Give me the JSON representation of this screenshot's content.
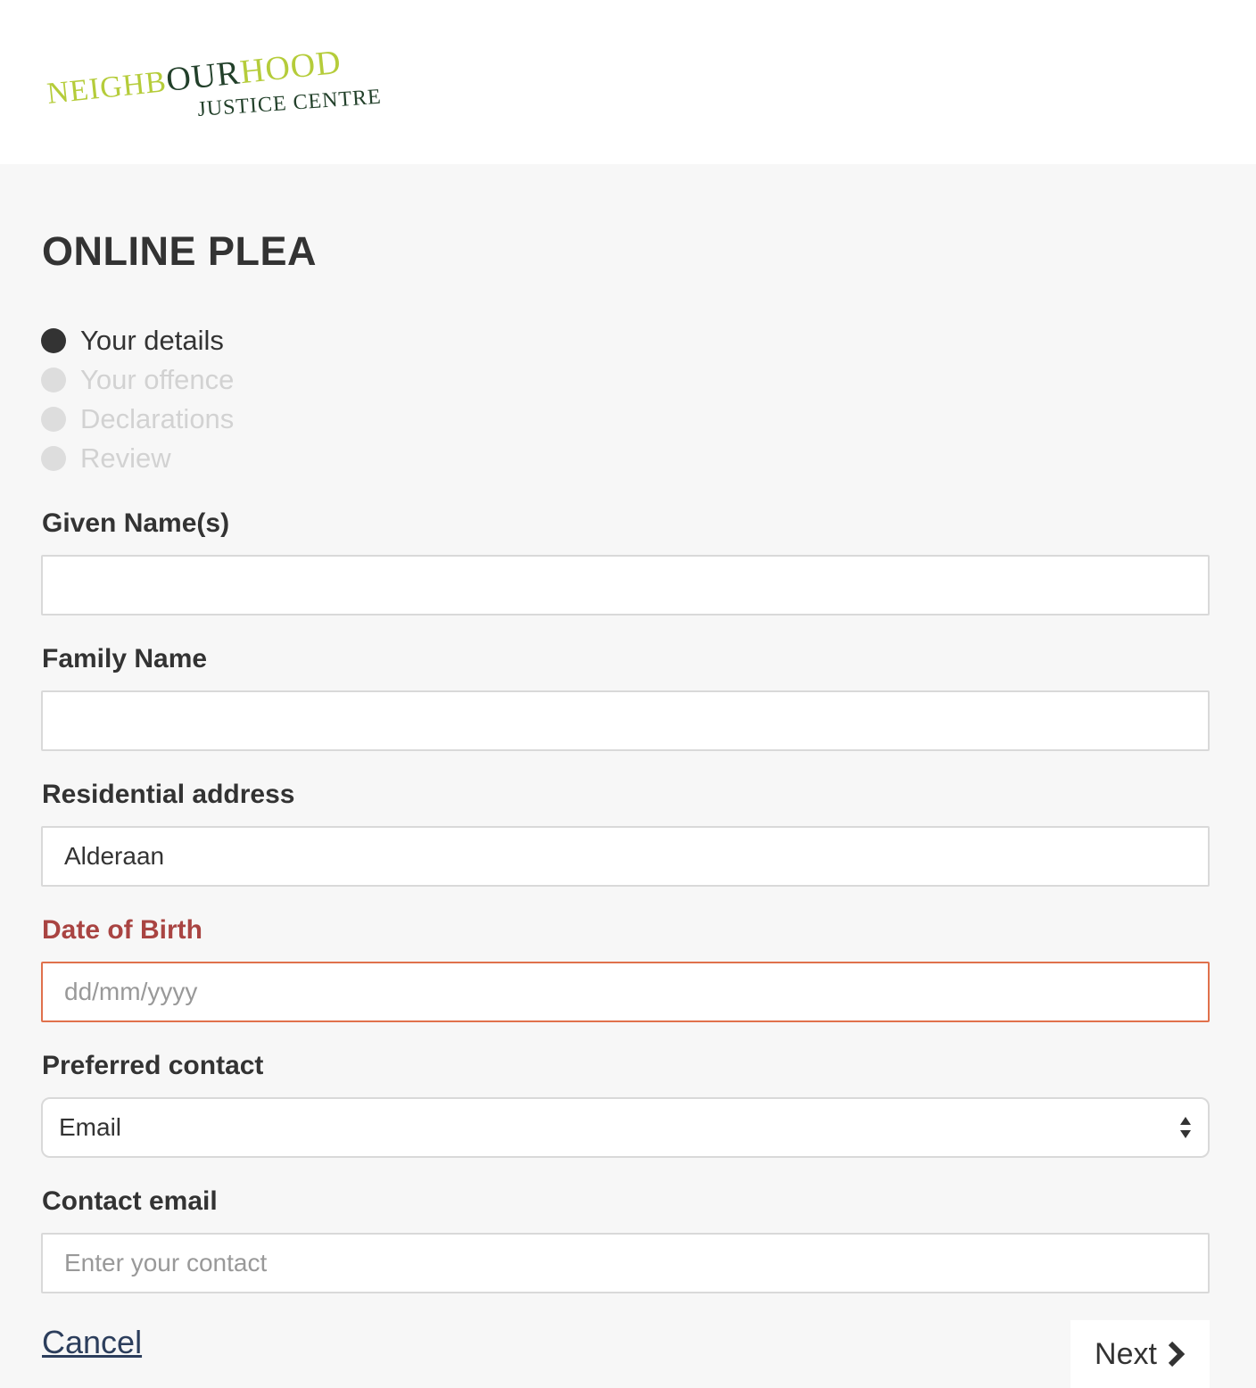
{
  "header": {
    "logo_line1_a": "NEIGHB",
    "logo_line1_b": "OUR",
    "logo_line1_c": "HOOD",
    "logo_line2": "JUSTICE CENTRE",
    "logo_colors": {
      "green": "#b5cc3a",
      "dark": "#22402a"
    }
  },
  "page": {
    "title": "ONLINE PLEA"
  },
  "steps": [
    {
      "label": "Your details",
      "active": true
    },
    {
      "label": "Your offence",
      "active": false
    },
    {
      "label": "Declarations",
      "active": false
    },
    {
      "label": "Review",
      "active": false
    }
  ],
  "form": {
    "given_name": {
      "label": "Given Name(s)",
      "value": "",
      "placeholder": ""
    },
    "family_name": {
      "label": "Family Name",
      "value": "",
      "placeholder": ""
    },
    "address": {
      "label": "Residential address",
      "value": "Alderaan",
      "placeholder": ""
    },
    "dob": {
      "label": "Date of Birth",
      "value": "",
      "placeholder": "dd/mm/yyyy",
      "error": true
    },
    "preferred_contact": {
      "label": "Preferred contact",
      "selected": "Email",
      "icon": "select-arrows-icon"
    },
    "contact_email": {
      "label": "Contact email",
      "value": "",
      "placeholder": "Enter your contact"
    }
  },
  "actions": {
    "cancel_label": "Cancel",
    "next_label": "Next",
    "next_icon": "chevron-right-icon"
  },
  "colors": {
    "background": "#f7f7f7",
    "error_label": "#a94442",
    "error_border": "#e0714c",
    "text": "#333333",
    "link": "#2c3e5c"
  }
}
